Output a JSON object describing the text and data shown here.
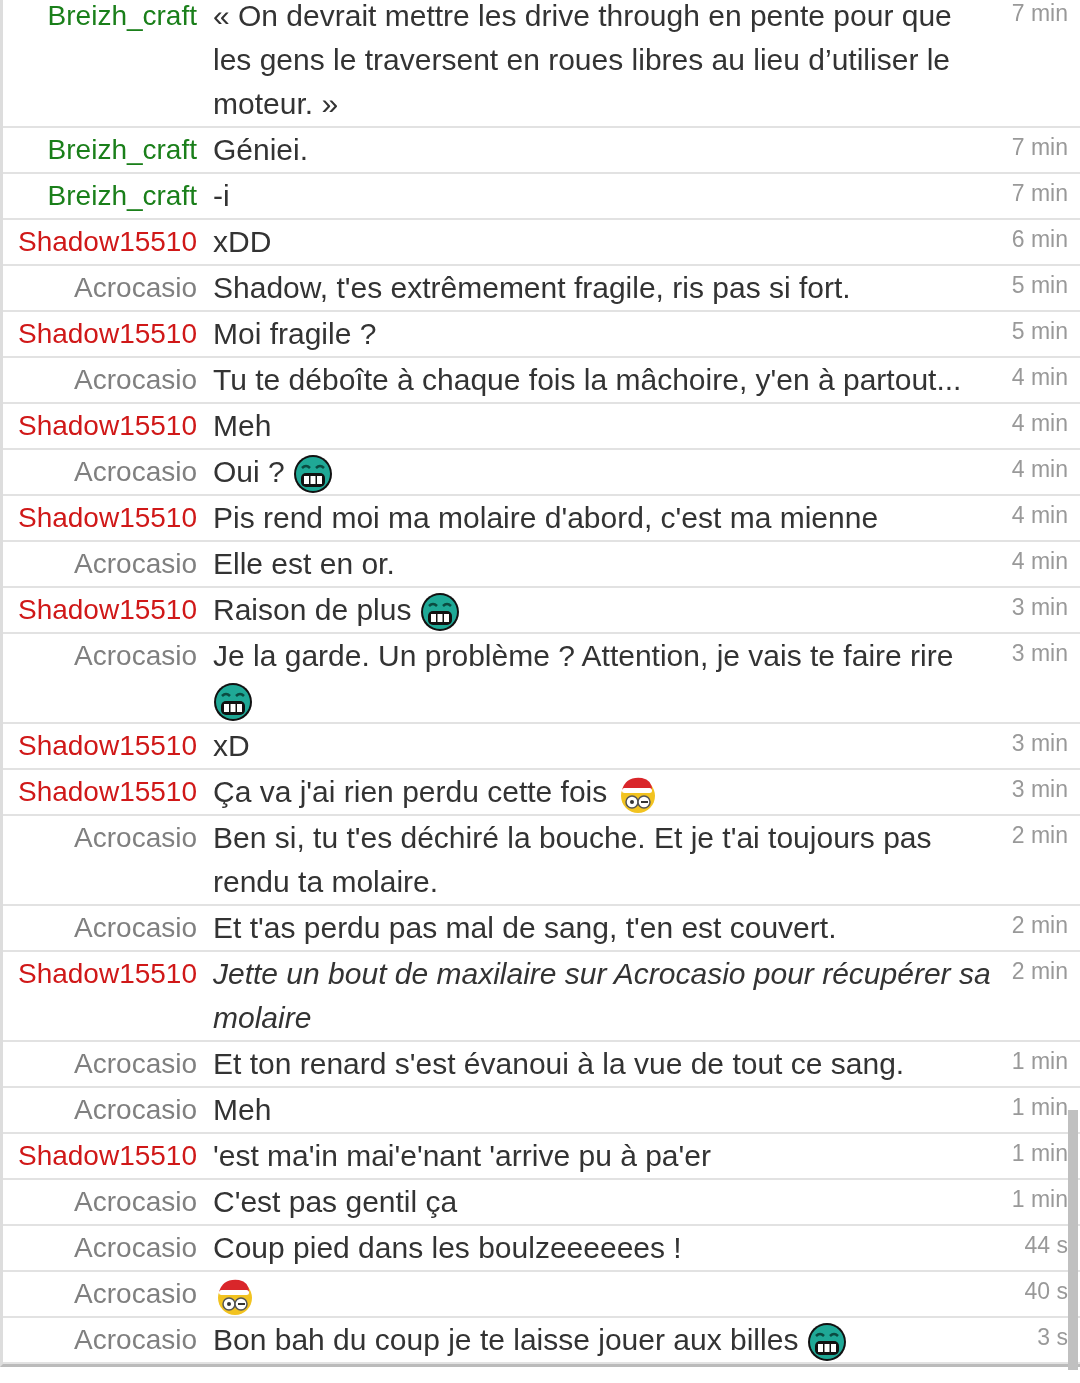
{
  "messages": [
    {
      "user": "Breizh_craft",
      "color": "#1a7f1a",
      "parts": [
        {
          "kind": "text",
          "text": "« On devrait mettre les drive through en pente pour que les gens le traversent en roues libres au lieu d’utiliser le moteur. »"
        }
      ],
      "emote": false,
      "time": "7 min"
    },
    {
      "user": "Breizh_craft",
      "color": "#1a7f1a",
      "parts": [
        {
          "kind": "text",
          "text": "Géniei."
        }
      ],
      "emote": false,
      "time": "7 min"
    },
    {
      "user": "Breizh_craft",
      "color": "#1a7f1a",
      "parts": [
        {
          "kind": "text",
          "text": "-i"
        }
      ],
      "emote": false,
      "time": "7 min"
    },
    {
      "user": "Shadow15510",
      "color": "#d01818",
      "parts": [
        {
          "kind": "text",
          "text": "xDD"
        }
      ],
      "emote": false,
      "time": "6 min"
    },
    {
      "user": "Acrocasio",
      "color": "#808080",
      "parts": [
        {
          "kind": "text",
          "text": "Shadow, t'es extrêmement fragile, ris pas si fort."
        }
      ],
      "emote": false,
      "time": "5 min"
    },
    {
      "user": "Shadow15510",
      "color": "#d01818",
      "parts": [
        {
          "kind": "text",
          "text": "Moi fragile ?"
        }
      ],
      "emote": false,
      "time": "5 min"
    },
    {
      "user": "Acrocasio",
      "color": "#808080",
      "parts": [
        {
          "kind": "text",
          "text": "Tu te déboîte à chaque fois la mâchoire, y'en à partout..."
        }
      ],
      "emote": false,
      "time": "4 min"
    },
    {
      "user": "Shadow15510",
      "color": "#d01818",
      "parts": [
        {
          "kind": "text",
          "text": "Meh"
        }
      ],
      "emote": false,
      "time": "4 min"
    },
    {
      "user": "Acrocasio",
      "color": "#808080",
      "parts": [
        {
          "kind": "text",
          "text": "Oui ?"
        },
        {
          "kind": "grin"
        }
      ],
      "emote": false,
      "time": "4 min"
    },
    {
      "user": "Shadow15510",
      "color": "#d01818",
      "parts": [
        {
          "kind": "text",
          "text": "Pis rend moi ma molaire d'abord, c'est ma mienne"
        }
      ],
      "emote": false,
      "time": "4 min"
    },
    {
      "user": "Acrocasio",
      "color": "#808080",
      "parts": [
        {
          "kind": "text",
          "text": "Elle est en or."
        }
      ],
      "emote": false,
      "time": "4 min"
    },
    {
      "user": "Shadow15510",
      "color": "#d01818",
      "parts": [
        {
          "kind": "text",
          "text": "Raison de plus"
        },
        {
          "kind": "grin"
        }
      ],
      "emote": false,
      "time": "3 min"
    },
    {
      "user": "Acrocasio",
      "color": "#808080",
      "parts": [
        {
          "kind": "text",
          "text": "Je la garde. Un problème ? Attention, je vais te faire rire"
        },
        {
          "kind": "grin"
        }
      ],
      "emote": false,
      "time": "3 min"
    },
    {
      "user": "Shadow15510",
      "color": "#d01818",
      "parts": [
        {
          "kind": "text",
          "text": "xD"
        }
      ],
      "emote": false,
      "time": "3 min"
    },
    {
      "user": "Shadow15510",
      "color": "#d01818",
      "parts": [
        {
          "kind": "text",
          "text": "Ça va j'ai rien perdu cette fois"
        },
        {
          "kind": "santa"
        }
      ],
      "emote": false,
      "time": "3 min"
    },
    {
      "user": "Acrocasio",
      "color": "#808080",
      "parts": [
        {
          "kind": "text",
          "text": "Ben si, tu t'es déchiré la bouche. Et je t'ai toujours pas rendu ta molaire."
        }
      ],
      "emote": false,
      "time": "2 min"
    },
    {
      "user": "Acrocasio",
      "color": "#808080",
      "parts": [
        {
          "kind": "text",
          "text": "Et t'as perdu pas mal de sang, t'en est couvert."
        }
      ],
      "emote": false,
      "time": "2 min"
    },
    {
      "user": "Shadow15510",
      "color": "#d01818",
      "parts": [
        {
          "kind": "text",
          "text": "Jette un bout de maxilaire sur Acrocasio pour récupérer sa molaire"
        }
      ],
      "emote": true,
      "time": "2 min"
    },
    {
      "user": "Acrocasio",
      "color": "#808080",
      "parts": [
        {
          "kind": "text",
          "text": "Et ton renard s'est évanoui à la vue de tout ce sang."
        }
      ],
      "emote": false,
      "time": "1 min"
    },
    {
      "user": "Acrocasio",
      "color": "#808080",
      "parts": [
        {
          "kind": "text",
          "text": "Meh"
        }
      ],
      "emote": false,
      "time": "1 min"
    },
    {
      "user": "Shadow15510",
      "color": "#d01818",
      "parts": [
        {
          "kind": "text",
          "text": "'est ma'in mai'e'nant 'arrive pu à pa'er"
        }
      ],
      "emote": false,
      "time": "1 min"
    },
    {
      "user": "Acrocasio",
      "color": "#808080",
      "parts": [
        {
          "kind": "text",
          "text": "C'est pas gentil ça"
        }
      ],
      "emote": false,
      "time": "1 min"
    },
    {
      "user": "Acrocasio",
      "color": "#808080",
      "parts": [
        {
          "kind": "text",
          "text": "Coup pied dans les boulzeeeeees !"
        }
      ],
      "emote": false,
      "time": "44 s"
    },
    {
      "user": "Acrocasio",
      "color": "#808080",
      "parts": [
        {
          "kind": "santa"
        }
      ],
      "time": "40 s"
    },
    {
      "user": "Acrocasio",
      "color": "#808080",
      "parts": [
        {
          "kind": "text",
          "text": "Bon bah du coup je te laisse jouer aux billes"
        },
        {
          "kind": "grin"
        }
      ],
      "emote": false,
      "time": "3 s"
    }
  ]
}
